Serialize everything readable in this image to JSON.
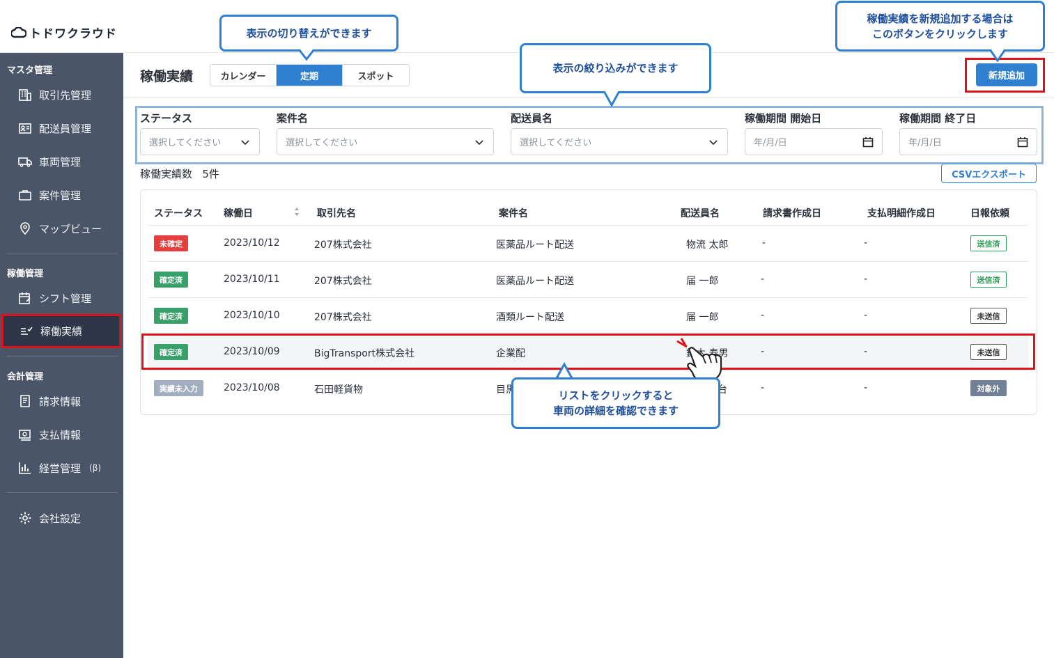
{
  "app": {
    "logo_text": "トドワクラウド"
  },
  "sidebar": {
    "sections": [
      {
        "title": "マスタ管理"
      },
      {
        "title": "稼働管理"
      },
      {
        "title": "会計管理"
      }
    ],
    "items": [
      {
        "label": "取引先管理",
        "icon": "building-icon"
      },
      {
        "label": "配送員管理",
        "icon": "id-card-icon"
      },
      {
        "label": "車両管理",
        "icon": "truck-icon"
      },
      {
        "label": "案件管理",
        "icon": "briefcase-icon"
      },
      {
        "label": "マップビュー",
        "icon": "map-pin-icon"
      },
      {
        "label": "シフト管理",
        "icon": "calendar-edit-icon"
      },
      {
        "label": "稼働実績",
        "icon": "checklist-icon"
      },
      {
        "label": "請求情報",
        "icon": "document-icon"
      },
      {
        "label": "支払情報",
        "icon": "payment-icon"
      },
      {
        "label": "経営管理",
        "suffix": "(β)",
        "icon": "bar-chart-icon"
      },
      {
        "label": "会社設定",
        "icon": "gear-icon"
      }
    ]
  },
  "header": {
    "title": "稼働実績",
    "view_tabs": [
      "カレンダー",
      "定期",
      "スポット"
    ],
    "active_tab": "定期",
    "new_button": "新規追加"
  },
  "filters": {
    "status": {
      "label": "ステータス",
      "placeholder": "選択してください"
    },
    "project": {
      "label": "案件名",
      "placeholder": "選択してください"
    },
    "driver": {
      "label": "配送員名",
      "placeholder": "選択してください"
    },
    "start": {
      "label": "稼働期間 開始日",
      "placeholder": "年/月/日"
    },
    "end": {
      "label": "稼働期間 終了日",
      "placeholder": "年/月/日"
    }
  },
  "summary": {
    "count_label": "稼働実績数",
    "count_value": "5件",
    "csv_button": "CSVエクスポート"
  },
  "table": {
    "columns": [
      "ステータス",
      "稼働日",
      "取引先名",
      "案件名",
      "配送員名",
      "請求書作成日",
      "支払明細作成日",
      "日報依頼"
    ],
    "rows": [
      {
        "status": "未確定",
        "date": "2023/10/12",
        "client": "207株式会社",
        "project": "医薬品ルート配送",
        "driver": "物流 太郎",
        "invoice": "-",
        "payment": "-",
        "report": "送信済"
      },
      {
        "status": "確定済",
        "date": "2023/10/11",
        "client": "207株式会社",
        "project": "医薬品ルート配送",
        "driver": "届 一郎",
        "invoice": "-",
        "payment": "-",
        "report": "送信済"
      },
      {
        "status": "確定済",
        "date": "2023/10/10",
        "client": "207株式会社",
        "project": "酒類ルート配送",
        "driver": "届 一郎",
        "invoice": "-",
        "payment": "-",
        "report": "未送信"
      },
      {
        "status": "確定済",
        "date": "2023/10/09",
        "client": "BigTransport株式会社",
        "project": "企業配",
        "driver": "鈴木 寿男",
        "invoice": "-",
        "payment": "-",
        "report": "未送信"
      },
      {
        "status": "実績未入力",
        "date": "2023/10/08",
        "client": "石田軽貨物",
        "project": "目黒",
        "driver": "台",
        "invoice": "-",
        "payment": "-",
        "report": "対象外"
      }
    ]
  },
  "colors": {
    "accent": "#2f80d1",
    "highlight": "#e0101a",
    "sidebar": "#4a5568",
    "badge_unconfirmed": "#e53e3e",
    "badge_confirmed": "#38a169",
    "badge_noinput": "#a0aec0",
    "badge_excluded": "#718096"
  },
  "callouts": {
    "view_switch": "表示の切り替えができます",
    "filter": "表示の絞り込みができます",
    "new_add_line1": "稼働実績を新規追加する場合は",
    "new_add_line2": "このボタンをクリックします",
    "list_line1": "リストをクリックすると",
    "list_line2": "車両の詳細を確認できます"
  }
}
